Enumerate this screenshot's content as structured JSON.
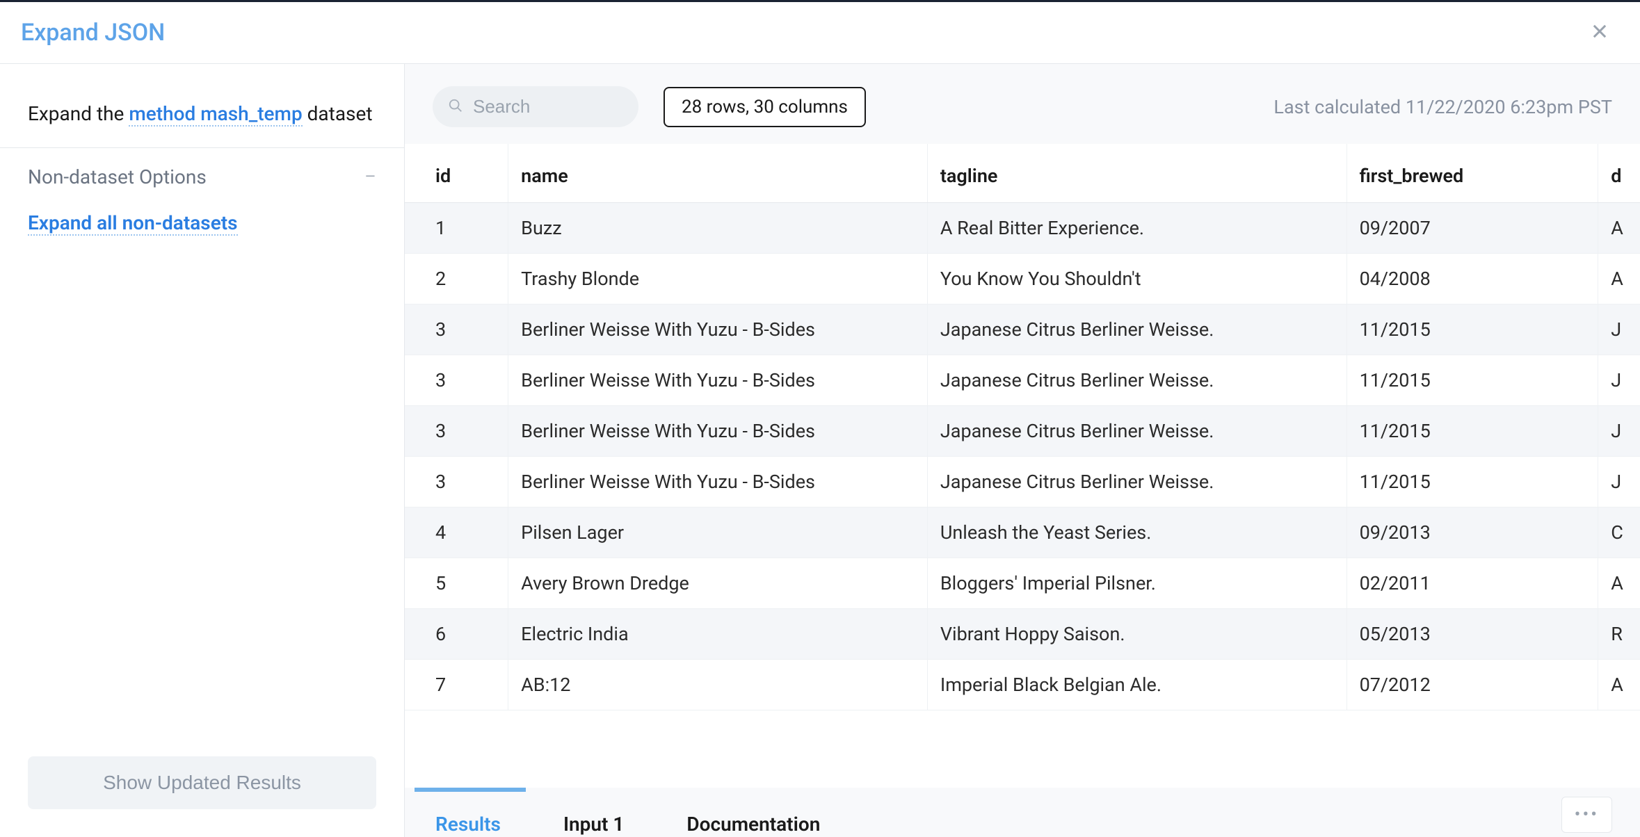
{
  "header": {
    "title": "Expand JSON"
  },
  "sidebar": {
    "expand_prefix": "Expand the ",
    "dataset_name": "method mash_temp",
    "expand_suffix": " dataset",
    "section_title": "Non-dataset Options",
    "expand_all_label": "Expand all non-datasets",
    "update_button": "Show Updated Results"
  },
  "toolbar": {
    "search_placeholder": "Search",
    "count_text": "28 rows, 30 columns",
    "last_calculated": "Last calculated 11/22/2020 6:23pm PST"
  },
  "table": {
    "columns": [
      "id",
      "name",
      "tagline",
      "first_brewed",
      "d"
    ],
    "rows": [
      {
        "id": "1",
        "name": "Buzz",
        "tagline": "A Real Bitter Experience.",
        "first_brewed": "09/2007",
        "d": "A"
      },
      {
        "id": "2",
        "name": "Trashy Blonde",
        "tagline": "You Know You Shouldn't",
        "first_brewed": "04/2008",
        "d": "A"
      },
      {
        "id": "3",
        "name": "Berliner Weisse With Yuzu - B-Sides",
        "tagline": "Japanese Citrus Berliner Weisse.",
        "first_brewed": "11/2015",
        "d": "J"
      },
      {
        "id": "3",
        "name": "Berliner Weisse With Yuzu - B-Sides",
        "tagline": "Japanese Citrus Berliner Weisse.",
        "first_brewed": "11/2015",
        "d": "J"
      },
      {
        "id": "3",
        "name": "Berliner Weisse With Yuzu - B-Sides",
        "tagline": "Japanese Citrus Berliner Weisse.",
        "first_brewed": "11/2015",
        "d": "J"
      },
      {
        "id": "3",
        "name": "Berliner Weisse With Yuzu - B-Sides",
        "tagline": "Japanese Citrus Berliner Weisse.",
        "first_brewed": "11/2015",
        "d": "J"
      },
      {
        "id": "4",
        "name": "Pilsen Lager",
        "tagline": "Unleash the Yeast Series.",
        "first_brewed": "09/2013",
        "d": "C"
      },
      {
        "id": "5",
        "name": "Avery Brown Dredge",
        "tagline": "Bloggers' Imperial Pilsner.",
        "first_brewed": "02/2011",
        "d": "A"
      },
      {
        "id": "6",
        "name": "Electric India",
        "tagline": "Vibrant Hoppy Saison.",
        "first_brewed": "05/2013",
        "d": "R"
      },
      {
        "id": "7",
        "name": "AB:12",
        "tagline": "Imperial Black Belgian Ale.",
        "first_brewed": "07/2012",
        "d": "A"
      }
    ]
  },
  "tabs": [
    {
      "label": "Results",
      "active": true
    },
    {
      "label": "Input 1",
      "active": false
    },
    {
      "label": "Documentation",
      "active": false
    }
  ]
}
